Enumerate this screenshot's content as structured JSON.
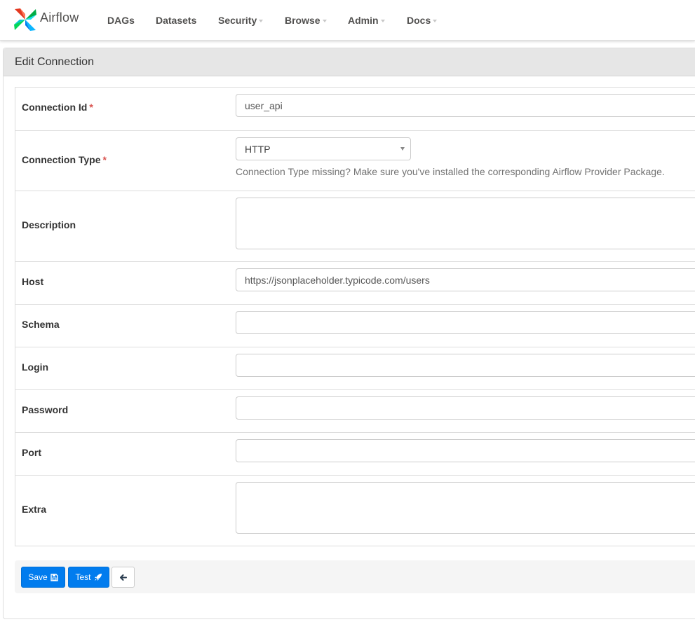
{
  "brand": {
    "name": "Airflow"
  },
  "nav": [
    {
      "label": "DAGs",
      "dropdown": false
    },
    {
      "label": "Datasets",
      "dropdown": false
    },
    {
      "label": "Security",
      "dropdown": true
    },
    {
      "label": "Browse",
      "dropdown": true
    },
    {
      "label": "Admin",
      "dropdown": true
    },
    {
      "label": "Docs",
      "dropdown": true
    }
  ],
  "panel": {
    "title": "Edit Connection"
  },
  "form": {
    "connection_id": {
      "label": "Connection Id",
      "required_mark": "*",
      "value": "user_api"
    },
    "connection_type": {
      "label": "Connection Type",
      "required_mark": "*",
      "value": "HTTP",
      "help": "Connection Type missing? Make sure you've installed the corresponding Airflow Provider Package."
    },
    "description": {
      "label": "Description",
      "value": ""
    },
    "host": {
      "label": "Host",
      "value": "https://jsonplaceholder.typicode.com/users"
    },
    "schema": {
      "label": "Schema",
      "value": ""
    },
    "login": {
      "label": "Login",
      "value": ""
    },
    "password": {
      "label": "Password",
      "value": ""
    },
    "port": {
      "label": "Port",
      "value": ""
    },
    "extra": {
      "label": "Extra",
      "value": ""
    }
  },
  "actions": {
    "save_label": "Save",
    "test_label": "Test",
    "back_icon": "arrow-left-icon"
  },
  "colors": {
    "primary": "#017cee",
    "required": "#d9534f",
    "heading_bg": "#e6e6e6"
  }
}
